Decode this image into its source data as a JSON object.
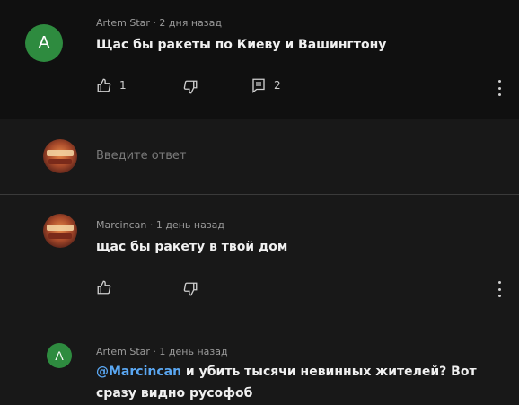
{
  "comments": [
    {
      "author": "Artem Star",
      "sep": "·",
      "time": "2 дня назад",
      "avatar_letter": "A",
      "text": "Щас бы ракеты по Киеву и Вашингтону",
      "likes": "1",
      "replies": "2"
    },
    {
      "author": "Marcincan",
      "sep": "·",
      "time": "1 день назад",
      "text": "щас бы ракету в твой дом"
    },
    {
      "author": "Artem Star",
      "sep": "·",
      "time": "1 день назад",
      "avatar_letter": "A",
      "mention": "@Marcincan",
      "text_line1": " и убить тысячи невинных жителей? Вот",
      "text_line2": "сразу видно русофоб"
    }
  ],
  "reply": {
    "placeholder": "Введите ответ"
  },
  "icons": {
    "like": "thumb-up-icon",
    "dislike": "thumb-down-icon",
    "replies": "comment-icon",
    "more": "more-vert-icon"
  },
  "colors": {
    "avatar": "#2e8b3f",
    "mention": "#5aa7f2"
  }
}
